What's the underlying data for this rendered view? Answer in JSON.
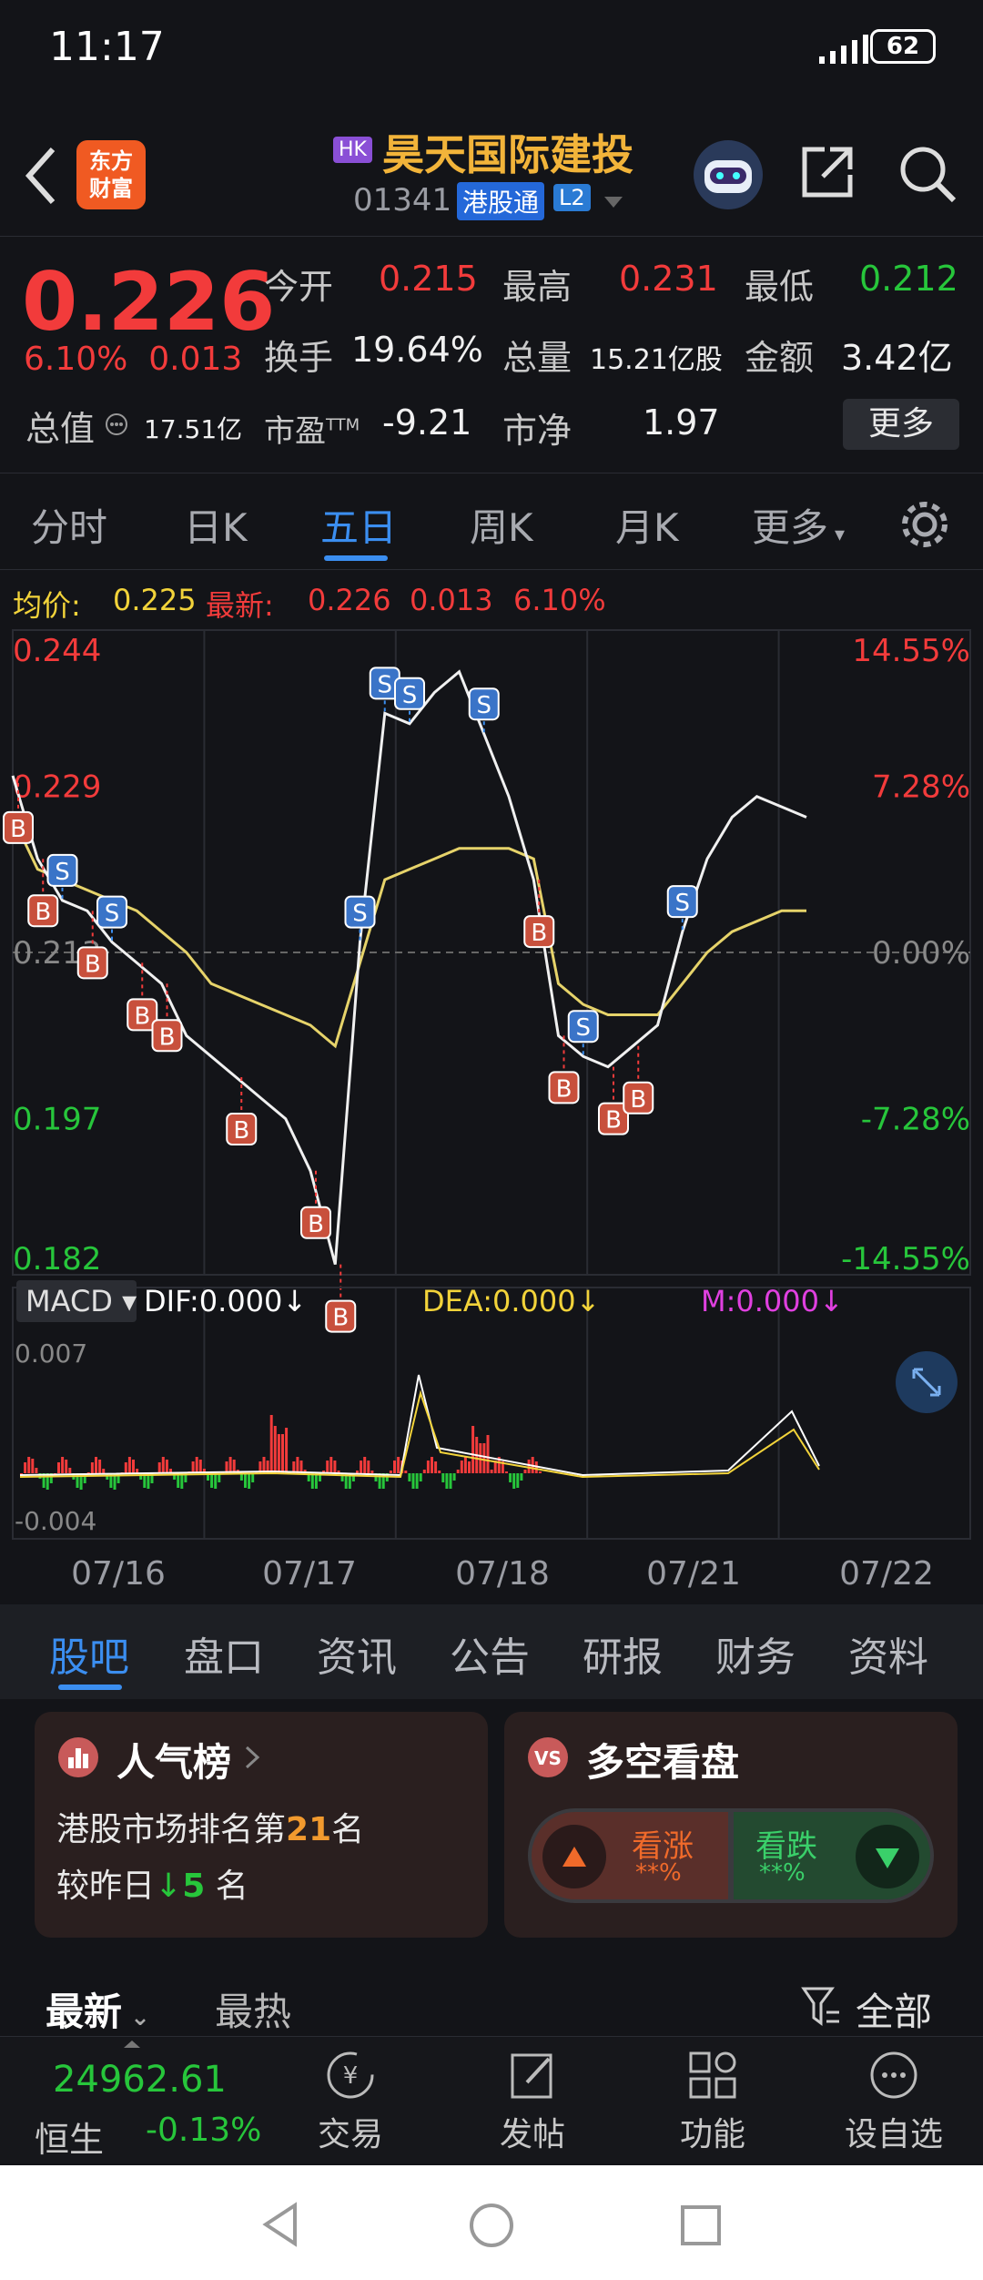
{
  "status": {
    "time": "11:17",
    "battery": "62"
  },
  "header": {
    "logo_line1": "东方",
    "logo_line2": "财富",
    "market_badge": "HK",
    "stock_name": "昊天国际建投",
    "code": "01341",
    "connect": "港股通",
    "level": "L2"
  },
  "quote": {
    "price": "0.226",
    "change_pct": "6.10%",
    "change": "0.013",
    "open_label": "今开",
    "open": "0.215",
    "high_label": "最高",
    "high": "0.231",
    "low_label": "最低",
    "low": "0.212",
    "turnover_label": "换手",
    "turnover": "19.64%",
    "volume_label": "总量",
    "volume": "15.21亿股",
    "amount_label": "金额",
    "amount": "3.42亿",
    "mktcap_label": "总值",
    "mktcap": "17.51亿",
    "pe_label": "市盈",
    "pe_sup": "TTM",
    "pe": "-9.21",
    "pb_label": "市净",
    "pb": "1.97",
    "more": "更多"
  },
  "tabs": [
    "分时",
    "日K",
    "五日",
    "周K",
    "月K",
    "更多"
  ],
  "infobar": {
    "avg_label": "均价:",
    "avg": "0.225",
    "latest_label": "最新:",
    "latest": "0.226",
    "chg": "0.013",
    "pct": "6.10%"
  },
  "chart_data": {
    "type": "line",
    "title": "",
    "y_left_ticks": [
      "0.244",
      "0.229",
      "0.213",
      "0.197",
      "0.182"
    ],
    "y_right_ticks": [
      "14.55%",
      "7.28%",
      "0.00%",
      "-7.28%",
      "-14.55%"
    ],
    "ylim": [
      0.182,
      0.244
    ],
    "x_labels": [
      "07/16",
      "07/17",
      "07/18",
      "07/21",
      "07/22"
    ],
    "series": [
      {
        "name": "",
        "values": [
          0.23,
          0.222,
          0.218,
          0.217,
          0.214,
          0.212,
          0.21,
          0.205,
          0.203,
          0.201,
          0.199,
          0.197,
          0.192,
          0.183,
          0.214,
          0.236,
          0.235,
          0.238,
          0.24,
          0.234,
          0.228,
          0.22,
          0.205,
          0.203,
          0.202,
          0.204,
          0.206,
          0.215,
          0.222,
          0.226,
          0.228,
          0.227,
          0.226
        ]
      },
      {
        "name": "均价:",
        "values": [
          0.226,
          0.221,
          0.22,
          0.219,
          0.218,
          0.217,
          0.215,
          0.213,
          0.21,
          0.209,
          0.208,
          0.207,
          0.206,
          0.204,
          0.212,
          0.22,
          0.221,
          0.222,
          0.223,
          0.223,
          0.223,
          0.222,
          0.21,
          0.208,
          0.207,
          0.207,
          0.207,
          0.21,
          0.213,
          0.215,
          0.216,
          0.217,
          0.217
        ]
      }
    ],
    "markers": {
      "buy": "B",
      "sell": "S"
    },
    "macd": {
      "label": "MACD",
      "dif": "DIF:0.000",
      "dea": "DEA:0.000",
      "m": "M:0.000",
      "top": "0.007",
      "bottom": "-0.004"
    }
  },
  "bottom_tabs": [
    "股吧",
    "盘口",
    "资讯",
    "公告",
    "研报",
    "财务",
    "资料"
  ],
  "popular": {
    "title": "人气榜",
    "line1_pre": "港股市场排名第",
    "rank": "21",
    "line1_post": "名",
    "line2_pre": "较昨日",
    "change": "5",
    "line2_post": "名"
  },
  "vote": {
    "title": "多空看盘",
    "bull": "看涨",
    "bull_val": "**%",
    "bear": "看跌",
    "bear_val": "**%"
  },
  "feed": {
    "latest": "最新",
    "hot": "最热",
    "filter": "全部"
  },
  "bottombar": {
    "index_value": "24962.61",
    "index_name": "恒生",
    "index_change": "-0.13%",
    "trade": "交易",
    "post": "发帖",
    "func": "功能",
    "watch": "设自选"
  }
}
